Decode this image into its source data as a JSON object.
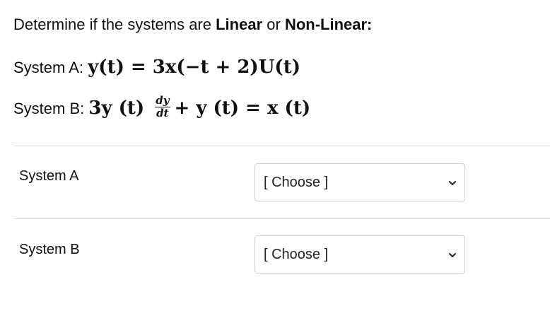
{
  "question": {
    "intro_prefix": "Determine if the systems are ",
    "linear": "Linear",
    "or": " or ",
    "nonlinear": "Non-Linear:",
    "system_a_label": "System A: ",
    "system_a_eq": "y(t) = 3x(−t + 2)U(t)",
    "system_b_label": "System B:  ",
    "system_b_lhs": "3y (t) ",
    "system_b_frac_num": "dy",
    "system_b_frac_den": "dt",
    "system_b_rhs": "+ y (t)  = x (t)"
  },
  "rows": [
    {
      "label": "System A",
      "selected": "[ Choose ]"
    },
    {
      "label": "System B",
      "selected": "[ Choose ]"
    }
  ],
  "icons": {
    "dropdown": "chevron-down-icon"
  }
}
